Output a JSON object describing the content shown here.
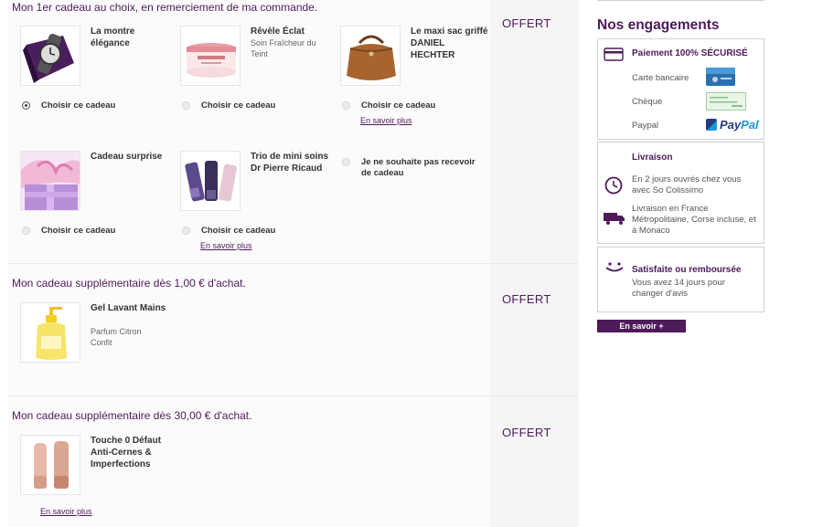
{
  "gifts": {
    "section1": {
      "title": "Mon 1er cadeau au choix, en remerciement de ma commande.",
      "offert": "OFFERT",
      "items": [
        {
          "name": "La montre élégance",
          "desc": "",
          "choose": "Choisir ce cadeau",
          "selected": true,
          "more": ""
        },
        {
          "name": "Rêvèle Éclat",
          "desc": "Soin Fraîcheur du Teint",
          "choose": "Choisir ce cadeau",
          "selected": false,
          "more": ""
        },
        {
          "name": "Le maxi sac griffé DANIEL HECHTER",
          "desc": "",
          "choose": "Choisir ce cadeau",
          "selected": false,
          "more": "En savoir plus"
        },
        {
          "name": "Cadeau surprise",
          "desc": "",
          "choose": "Choisir ce cadeau",
          "selected": false,
          "more": ""
        },
        {
          "name": "Trio de mini soins Dr Pierre Ricaud",
          "desc": "",
          "choose": "Choisir ce cadeau",
          "selected": false,
          "more": "En savoir plus"
        }
      ],
      "no_gift": "Je ne souhaite pas recevoir de cadeau"
    },
    "section2": {
      "title": "Mon cadeau supplémentaire dès 1,00 € d'achat.",
      "offert": "OFFERT",
      "item": {
        "name": "Gel Lavant Mains",
        "desc": "Parfum Citron Confit"
      }
    },
    "section3": {
      "title": "Mon cadeau supplémentaire dès 30,00 € d'achat.",
      "offert": "OFFERT",
      "item": {
        "name": "Touche 0 Défaut Anti-Cernes & Imperfections",
        "more": "En savoir plus"
      }
    }
  },
  "engagements": {
    "title": "Nos engagements",
    "payment": {
      "head": "Paiement 100% SÉCURISÉ",
      "methods": [
        "Carte bancaire",
        "Chèque",
        "Paypal"
      ],
      "paypal_logo": "PayPal"
    },
    "delivery": {
      "head": "Livraison",
      "line1": "En 2 jours ouvrés chez vous avec So Colissimo",
      "line2": "Livraison en France Métropolitaine, Corse incluse, et à Monaco"
    },
    "satisfaction": {
      "head": "Satisfaite ou remboursée",
      "text": "Vous avez 14 jours pour changer d'avis"
    },
    "more_button": "En savoir +"
  },
  "colors": {
    "brand": "#4e1a5a",
    "paypal_dark": "#253b80",
    "paypal_light": "#179bd7"
  },
  "icons": [
    "card-icon",
    "clock-icon",
    "truck-icon",
    "smile-icon"
  ]
}
